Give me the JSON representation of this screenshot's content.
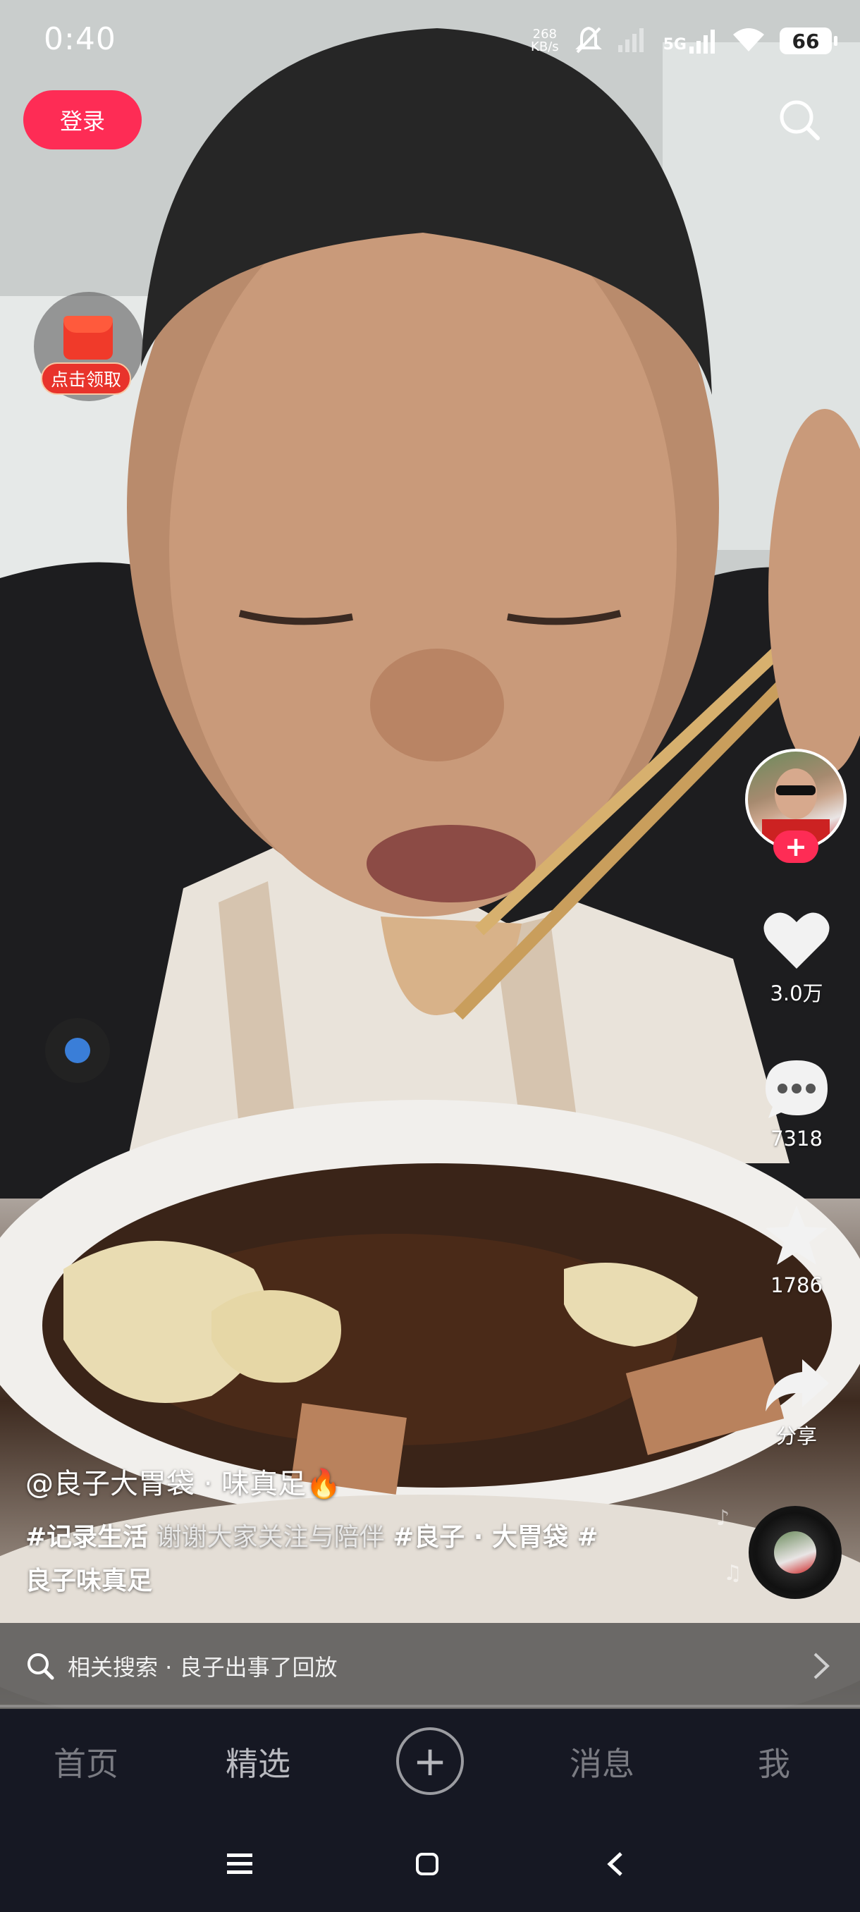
{
  "status_bar": {
    "time": "0:40",
    "net_speed_value": "268",
    "net_speed_unit": "KB/s",
    "network": "5G",
    "battery": "66"
  },
  "top": {
    "login_label": "登录"
  },
  "redpacket": {
    "label": "点击领取"
  },
  "actions": {
    "like_count": "3.0万",
    "comment_count": "7318",
    "favorite_count": "1786",
    "share_label": "分享"
  },
  "caption": {
    "author": "@良子大胃袋 · 味真足🔥",
    "tag1": "#记录生活",
    "text1": " 谢谢大家关注与陪伴 ",
    "tag2": "#良子 · 大胃袋",
    "tag3": " #",
    "line2": "良子味真足"
  },
  "related_search": {
    "text": "相关搜索 · 良子出事了回放"
  },
  "progress": {
    "fraction": 0.0
  },
  "tabbar": {
    "home": "首页",
    "featured": "精选",
    "plus": "+",
    "messages": "消息",
    "me": "我"
  },
  "colors": {
    "accent": "#fe2c55",
    "tabbar_bg": "#161823"
  }
}
